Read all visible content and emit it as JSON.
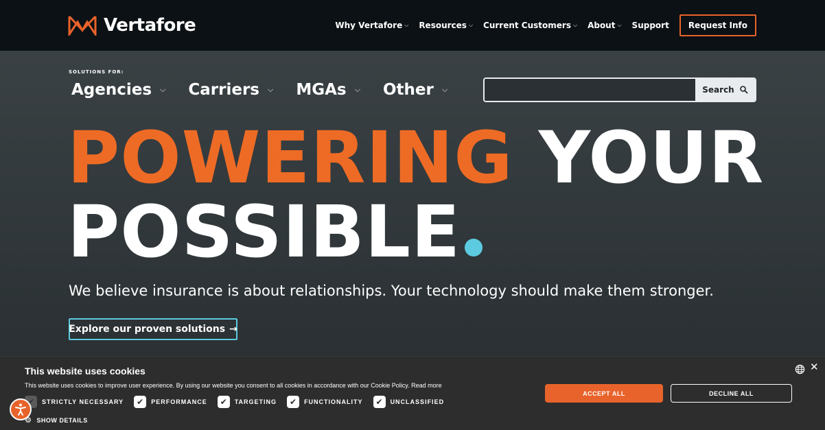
{
  "brand": {
    "name": "Vertafore",
    "accent": "#e8632b",
    "cyan": "#5ccbe0"
  },
  "nav": {
    "items": [
      {
        "label": "Why Vertafore",
        "dropdown": true
      },
      {
        "label": "Resources",
        "dropdown": true
      },
      {
        "label": "Current Customers",
        "dropdown": true
      },
      {
        "label": "About",
        "dropdown": true
      },
      {
        "label": "Support",
        "dropdown": false
      }
    ],
    "cta": "Request Info"
  },
  "solutions": {
    "label": "SOLUTIONS FOR:",
    "items": [
      "Agencies",
      "Carriers",
      "MGAs",
      "Other"
    ]
  },
  "search": {
    "button_label": "Search",
    "value": "",
    "icon": "magnifier-icon"
  },
  "hero": {
    "headline_orange": "POWERING",
    "headline_white_1": "YOUR",
    "headline_white_2": "POSSIBLE",
    "subline": "We believe insurance is about relationships. Your technology should make them stronger.",
    "cta": "Explore our proven solutions"
  },
  "cookie": {
    "title": "This website uses cookies",
    "text": "This website uses cookies to improve user experience. By using our website you consent to all cookies in accordance with our Cookie Policy.",
    "read_more": "Read more",
    "options": [
      {
        "label": "STRICTLY NECESSARY",
        "checked": true,
        "disabled": true
      },
      {
        "label": "PERFORMANCE",
        "checked": true,
        "disabled": false
      },
      {
        "label": "TARGETING",
        "checked": true,
        "disabled": false
      },
      {
        "label": "FUNCTIONALITY",
        "checked": true,
        "disabled": false
      },
      {
        "label": "UNCLASSIFIED",
        "checked": true,
        "disabled": false
      }
    ],
    "show_details": "SHOW DETAILS",
    "accept": "ACCEPT ALL",
    "decline": "DECLINE ALL"
  }
}
